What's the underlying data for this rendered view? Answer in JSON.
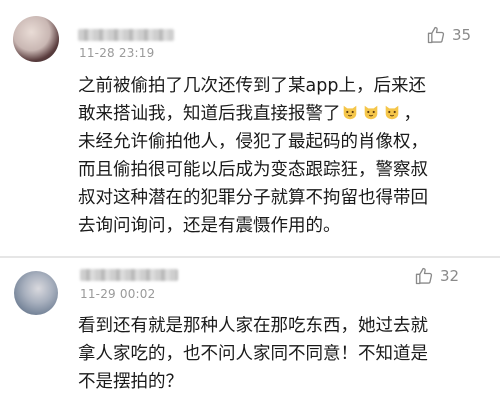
{
  "comments": [
    {
      "timestamp": "11-28 23:19",
      "likes": "35",
      "text_lines": [
        "之前被偷拍了几次还传到了某app上，后来还",
        "敢来搭讪我，知道后我直接报警了",
        "未经允许偷拍他人，侵犯了最起码的肖像权，",
        "而且偷拍很可能以后成为变态跟踪狂，警察叔",
        "叔对这种潜在的犯罪分子就算不拘留也得带回",
        "去询问询问，还是有震慑作用的。"
      ],
      "line2_suffix": "，",
      "emojis": [
        "cat-face-icon",
        "cat-face-icon",
        "cat-face-icon"
      ]
    },
    {
      "timestamp": "11-29 00:02",
      "likes": "32",
      "text_lines": [
        "看到还有就是那种人家在那吃东西，她过去就",
        "拿人家吃的，也不问人家同不同意！不知道是",
        "不是摆拍的？"
      ]
    }
  ],
  "colors": {
    "text": "#1a1a1a",
    "meta": "#9a9a9a",
    "like": "#8a8a8a",
    "emoji": "#f5c64a"
  }
}
